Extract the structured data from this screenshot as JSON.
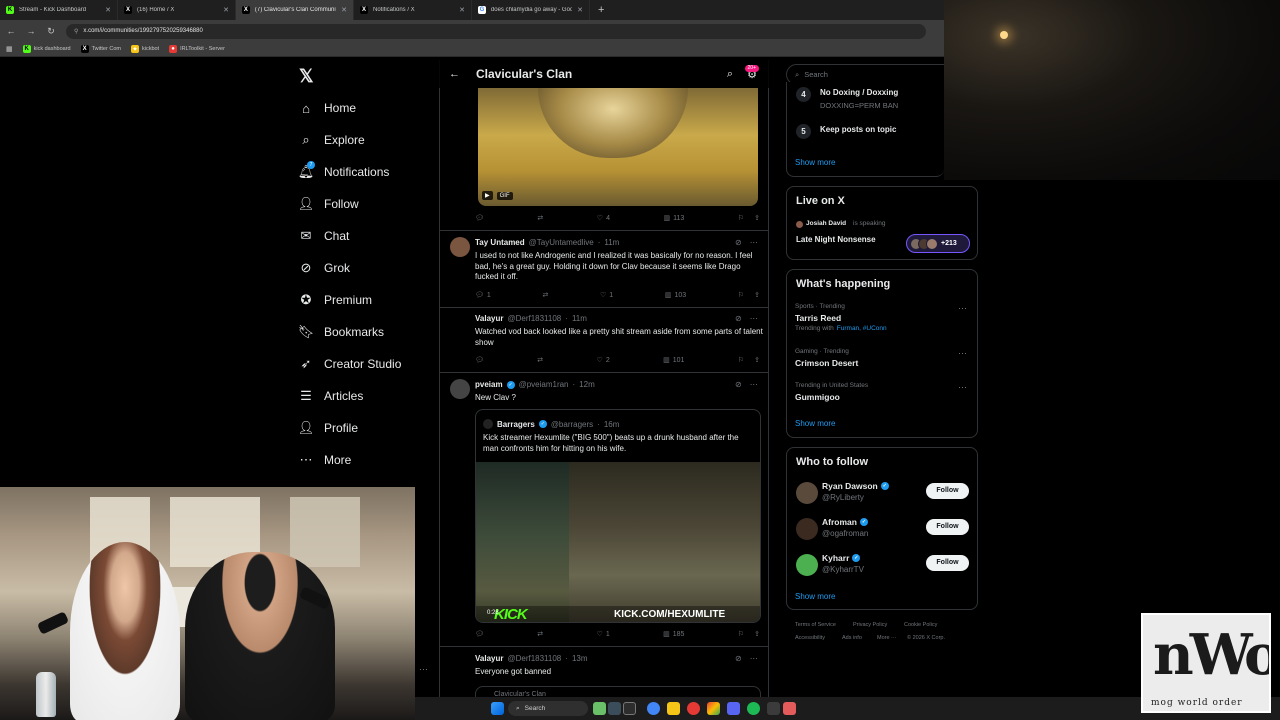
{
  "browser": {
    "tabs": [
      {
        "title": "Stream - Kick Dashboard",
        "fav": "K",
        "color": "#53fc18",
        "active": false
      },
      {
        "title": "(16) Home / X",
        "fav": "X",
        "color": "#000000",
        "active": false
      },
      {
        "title": "(7) Clavicular's Clan Communit",
        "fav": "X",
        "color": "#000000",
        "active": true
      },
      {
        "title": "Notifications / X",
        "fav": "X",
        "color": "#000000",
        "active": false
      },
      {
        "title": "does chlamydia go away - Goo",
        "fav": "G",
        "color": "#ffffff",
        "active": false
      }
    ],
    "url": "x.com/i/communities/1992797520259346880",
    "bookmarks": [
      {
        "label": "kick dashboard",
        "fav": "K",
        "color": "#53fc18"
      },
      {
        "label": "Twitter Com",
        "fav": "X",
        "color": "#000000"
      },
      {
        "label": "kickbot",
        "fav": "✦",
        "color": "#f5c518"
      },
      {
        "label": "IRLToolkit - Server",
        "fav": "●",
        "color": "#e53935"
      }
    ]
  },
  "nav": {
    "logo": "𝕏",
    "items": [
      {
        "label": "Home",
        "icon": "home-icon",
        "glyph": "⌂"
      },
      {
        "label": "Explore",
        "icon": "search-icon",
        "glyph": "⌕"
      },
      {
        "label": "Notifications",
        "icon": "bell-icon",
        "glyph": "🔔︎",
        "badge": "7"
      },
      {
        "label": "Follow",
        "icon": "person-add-icon",
        "glyph": "👤︎"
      },
      {
        "label": "Chat",
        "icon": "mail-icon",
        "glyph": "✉"
      },
      {
        "label": "Grok",
        "icon": "grok-icon",
        "glyph": "⊘"
      },
      {
        "label": "Premium",
        "icon": "premium-icon",
        "glyph": "✪"
      },
      {
        "label": "Bookmarks",
        "icon": "bookmark-icon",
        "glyph": "🔖︎"
      },
      {
        "label": "Creator Studio",
        "icon": "rocket-icon",
        "glyph": "➶"
      },
      {
        "label": "Articles",
        "icon": "article-icon",
        "glyph": "☰"
      },
      {
        "label": "Profile",
        "icon": "profile-icon",
        "glyph": "👤︎"
      },
      {
        "label": "More",
        "icon": "more-icon",
        "glyph": "⋯"
      }
    ]
  },
  "header": {
    "title": "Clavicular's Clan",
    "notif_count": "20+"
  },
  "gif_post": {
    "tag": "GIF",
    "stats": {
      "replies": "",
      "reposts": "",
      "likes": "4",
      "views": "113"
    }
  },
  "tweets": [
    {
      "name": "Tay Untamed",
      "handle": "@TayUntamedlive",
      "time": "11m",
      "text": "I used to not like Androgenic and I realized it was basically for no reason. I feel bad, he's a great guy. Holding it down for Clav because it seems like Drago fucked it off.",
      "stats": {
        "replies": "1",
        "reposts": "",
        "likes": "1",
        "views": "103"
      }
    },
    {
      "name": "Valayur",
      "handle": "@Derf1831108",
      "time": "11m",
      "text": "Watched vod back looked like a pretty shit stream aside from some parts of talent show",
      "stats": {
        "replies": "",
        "reposts": "",
        "likes": "2",
        "views": "101"
      }
    },
    {
      "name": "pveiam",
      "handle": "@pveiam1ran",
      "time": "12m",
      "text": "New Clav ?",
      "stats": {
        "replies": "",
        "reposts": "",
        "likes": "1",
        "views": "185"
      }
    },
    {
      "name": "Valayur",
      "handle": "@Derf1831108",
      "time": "13m",
      "text": "Everyone got banned"
    }
  ],
  "quote": {
    "name": "Barragers",
    "handle": "@barragers",
    "time": "16m",
    "text": "Kick streamer Hexumlite (\"BIG 500\") beats up a drunk husband after the man confronts him for hitting on his wife.",
    "video_time": "0:28",
    "kick_logo": "KICK",
    "kick_url": "KICK.COM/HEXUMLITE"
  },
  "next_community_label": "Clavicular's Clan",
  "right": {
    "search_placeholder": "Search",
    "rules": [
      {
        "num": "4",
        "title": "No Doxing / Doxxing",
        "sub": "DOXXING=PERM BAN"
      },
      {
        "num": "5",
        "title": "Keep posts on topic",
        "sub": ""
      }
    ],
    "show_more": "Show more",
    "live": {
      "title": "Live on X",
      "speaker": "Josiah David",
      "speaking": "is speaking",
      "space": "Late Night Nonsense",
      "count": "+213"
    },
    "happening": {
      "title": "What's happening",
      "trends": [
        {
          "cat": "Sports · Trending",
          "name": "Tarris Reed",
          "extra": "Trending with",
          "links": "Furman, #UConn"
        },
        {
          "cat": "Gaming · Trending",
          "name": "Crimson Desert",
          "extra": "",
          "links": ""
        },
        {
          "cat": "Trending in United States",
          "name": "Gummigoo",
          "extra": "",
          "links": ""
        }
      ]
    },
    "wtf": {
      "title": "Who to follow",
      "follow_label": "Follow",
      "users": [
        {
          "name": "Ryan Dawson",
          "handle": "@RyLiberty",
          "color": "#5a4a3c"
        },
        {
          "name": "Afroman",
          "handle": "@ogafroman",
          "color": "#3b2a20"
        },
        {
          "name": "Kyharr",
          "handle": "@KyharrTV",
          "color": "#4caf50"
        }
      ]
    },
    "footer": [
      "Terms of Service",
      "Privacy Policy",
      "Cookie Policy",
      "Accessibility",
      "Ads info",
      "More ···",
      "© 2026 X Corp."
    ]
  },
  "taskbar": {
    "search": "Search"
  },
  "overlay": {
    "logo_letters": "nWo",
    "logo_tagline": "mog world order"
  }
}
